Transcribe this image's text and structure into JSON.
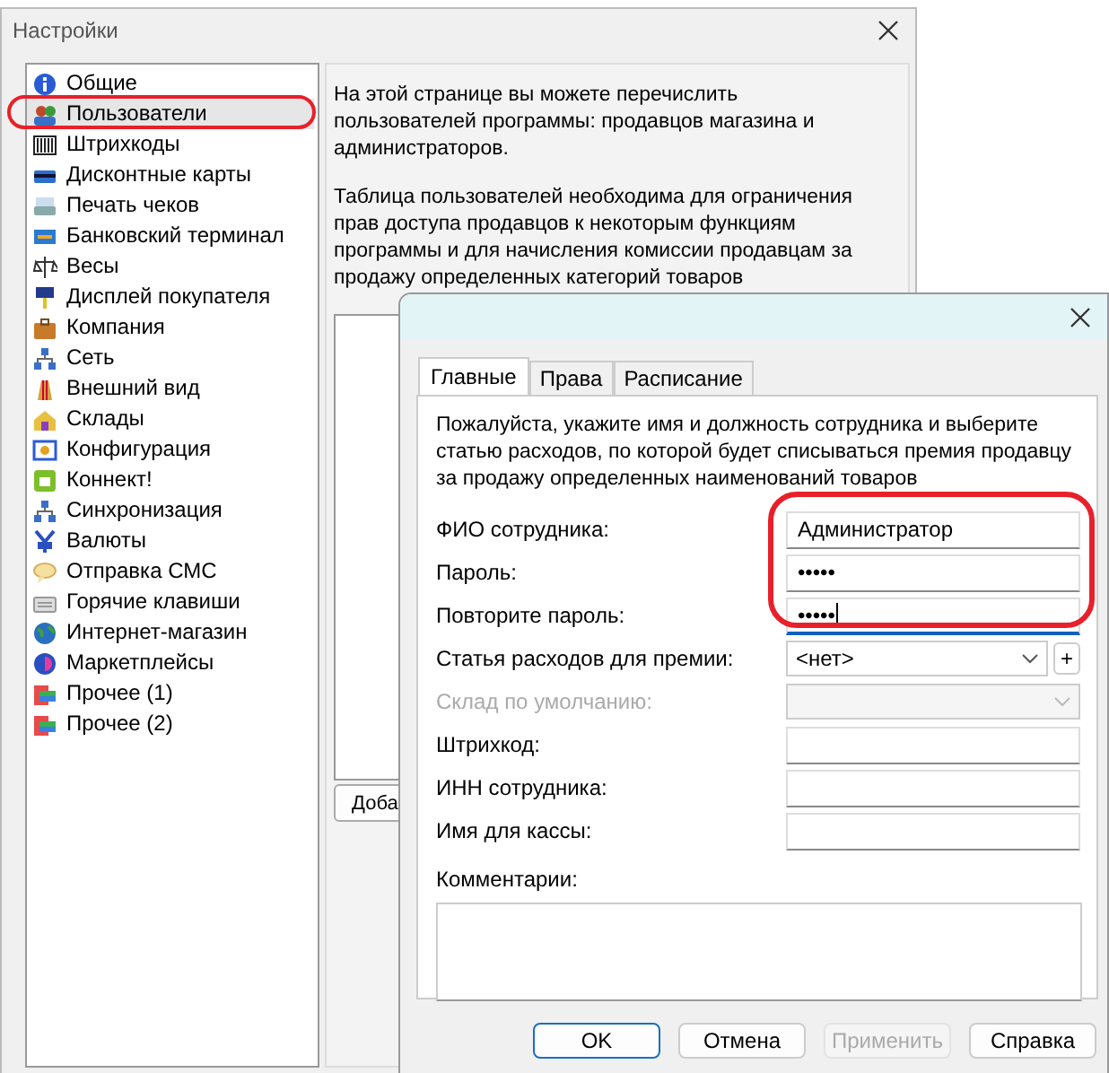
{
  "settings_window": {
    "title": "Настройки",
    "sidebar": {
      "items": [
        {
          "label": "Общие",
          "selected": false
        },
        {
          "label": "Пользователи",
          "selected": true
        },
        {
          "label": "Штрихкоды",
          "selected": false
        },
        {
          "label": "Дисконтные карты",
          "selected": false
        },
        {
          "label": "Печать чеков",
          "selected": false
        },
        {
          "label": "Банковский терминал",
          "selected": false
        },
        {
          "label": "Весы",
          "selected": false
        },
        {
          "label": "Дисплей покупателя",
          "selected": false
        },
        {
          "label": "Компания",
          "selected": false
        },
        {
          "label": "Сеть",
          "selected": false
        },
        {
          "label": "Внешний вид",
          "selected": false
        },
        {
          "label": "Склады",
          "selected": false
        },
        {
          "label": "Конфигурация",
          "selected": false
        },
        {
          "label": "Коннект!",
          "selected": false
        },
        {
          "label": "Синхронизация",
          "selected": false
        },
        {
          "label": "Валюты",
          "selected": false
        },
        {
          "label": "Отправка СМС",
          "selected": false
        },
        {
          "label": "Горячие клавиши",
          "selected": false
        },
        {
          "label": "Интернет-магазин",
          "selected": false
        },
        {
          "label": "Маркетплейсы",
          "selected": false
        },
        {
          "label": "Прочее (1)",
          "selected": false
        },
        {
          "label": "Прочее (2)",
          "selected": false
        }
      ]
    },
    "paragraphs": [
      "На этой странице вы можете перечислить пользователей программы: продавцов магазина и администраторов.",
      "Таблица пользователей необходима для ограничения прав доступа продавцов к некоторым функциям программы и для начисления комиссии продавцам за продажу определенных категорий товаров"
    ],
    "add_button": "Доба"
  },
  "user_dialog": {
    "tabs": [
      {
        "label": "Главные",
        "selected": true
      },
      {
        "label": "Права",
        "selected": false
      },
      {
        "label": "Расписание",
        "selected": false
      }
    ],
    "description": "Пожалуйста, укажите имя и должность сотрудника и выберите статью расходов, по которой будет списываться премия продавцу за продажу определенных наименований товаров",
    "fields": [
      {
        "kind": "text",
        "label": "ФИО сотрудника:",
        "value": "Администратор",
        "focused": false,
        "disabled": false
      },
      {
        "kind": "text",
        "label": "Пароль:",
        "value": "•••••",
        "focused": false,
        "disabled": false
      },
      {
        "kind": "text",
        "label": "Повторите пароль:",
        "value": "•••••",
        "focused": true,
        "disabled": false
      },
      {
        "kind": "combo",
        "label": "Статья расходов для премии:",
        "value": "<нет>",
        "add": "+",
        "disabled": false
      },
      {
        "kind": "combo",
        "label": "Склад по умолчанию:",
        "disabled": true
      },
      {
        "kind": "text",
        "label": "Штрихкод:",
        "focused": false,
        "disabled": false
      },
      {
        "kind": "text",
        "label": "ИНН сотрудника:",
        "focused": false,
        "disabled": false
      },
      {
        "kind": "text",
        "label": "Имя для кассы:",
        "focused": false,
        "disabled": false
      }
    ],
    "comments_label": "Комментарии:",
    "buttons": [
      {
        "label": "OK",
        "default": true,
        "disabled": false
      },
      {
        "label": "Отмена",
        "default": false,
        "disabled": false
      },
      {
        "label": "Применить",
        "default": false,
        "disabled": true
      },
      {
        "label": "Справка",
        "default": false,
        "disabled": false
      }
    ]
  }
}
